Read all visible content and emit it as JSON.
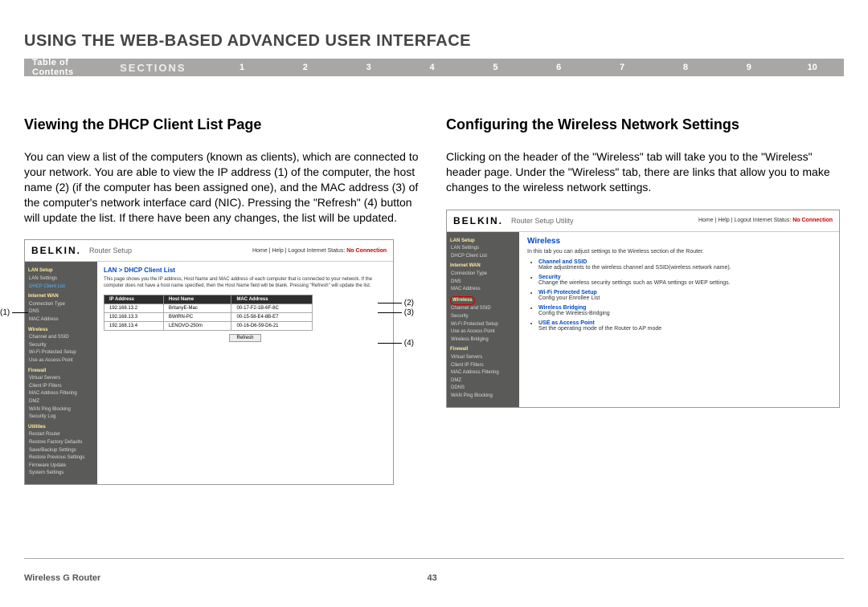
{
  "header": {
    "title": "USING THE WEB-BASED ADVANCED USER INTERFACE",
    "toc_label": "Table of Contents",
    "sections_label": "SECTIONS",
    "section_numbers": [
      "1",
      "2",
      "3",
      "4",
      "5",
      "6",
      "7",
      "8",
      "9",
      "10"
    ],
    "active_section": "6"
  },
  "left_col": {
    "heading": "Viewing the DHCP Client List Page",
    "paragraph": "You can view a list of the computers (known as clients), which are connected to your network. You are able to view the IP address (1) of the computer, the host name (2) (if the computer has been assigned one), and the MAC address (3) of the computer's network interface card (NIC). Pressing the \"Refresh\" (4) button will update the list. If there have been any changes, the list will be updated.",
    "callouts": {
      "c1": "(1)",
      "c2": "(2)",
      "c3": "(3)",
      "c4": "(4)"
    },
    "router": {
      "logo": "BELKIN.",
      "title": "Router Setup",
      "top_links": "Home | Help | Logout   Internet Status:",
      "status": "No Connection",
      "crumb": "LAN > DHCP Client List",
      "desc": "This page shows you the IP address, Host Name and MAC address of each computer that is connected to your network. If the computer does not have a host name specified, then the Host Name field will be blank. Pressing \"Refresh\" will update the list.",
      "table": {
        "headers": [
          "IP Address",
          "Host Name",
          "MAC Address"
        ],
        "rows": [
          [
            "192.168.13.2",
            "BritanyE-Mac",
            "00-17-F2-1B-6F-8C"
          ],
          [
            "192.168.13.3",
            "BWIRN-PC",
            "00-15-58-E4-8B-E7"
          ],
          [
            "192.168.13.4",
            "LENOVO-250m",
            "00-16-D6-59-D6-21"
          ]
        ]
      },
      "refresh": "Refresh",
      "sidebar": [
        {
          "t": "group",
          "v": "LAN Setup"
        },
        {
          "t": "item",
          "v": "LAN Settings"
        },
        {
          "t": "item sel",
          "v": "DHCP Client List"
        },
        {
          "t": "group",
          "v": "Internet WAN"
        },
        {
          "t": "item",
          "v": "Connection Type"
        },
        {
          "t": "item",
          "v": "DNS"
        },
        {
          "t": "item",
          "v": "MAC Address"
        },
        {
          "t": "group",
          "v": "Wireless"
        },
        {
          "t": "item",
          "v": "Channel and SSID"
        },
        {
          "t": "item",
          "v": "Security"
        },
        {
          "t": "item",
          "v": "Wi-Fi Protected Setup"
        },
        {
          "t": "item",
          "v": "Use as Access Point"
        },
        {
          "t": "group",
          "v": "Firewall"
        },
        {
          "t": "item",
          "v": "Virtual Servers"
        },
        {
          "t": "item",
          "v": "Client IP Filters"
        },
        {
          "t": "item",
          "v": "MAC Address Filtering"
        },
        {
          "t": "item",
          "v": "DMZ"
        },
        {
          "t": "item",
          "v": "WAN Ping Blocking"
        },
        {
          "t": "item",
          "v": "Security Log"
        },
        {
          "t": "group",
          "v": "Utilities"
        },
        {
          "t": "item",
          "v": "Restart Router"
        },
        {
          "t": "item",
          "v": "Restore Factory Defaults"
        },
        {
          "t": "item",
          "v": "Save/Backup Settings"
        },
        {
          "t": "item",
          "v": "Restore Previous Settings"
        },
        {
          "t": "item",
          "v": "Firmware Update"
        },
        {
          "t": "item",
          "v": "System Settings"
        }
      ]
    }
  },
  "right_col": {
    "heading": "Configuring the Wireless Network Settings",
    "paragraph": "Clicking on the header of the \"Wireless\" tab will take you to the \"Wireless\" header page. Under the \"Wireless\" tab, there are links that allow you to make changes to the wireless network settings.",
    "router": {
      "logo": "BELKIN.",
      "title": "Router Setup Utility",
      "top_links": "Home | Help | Logout   Internet Status:",
      "status": "No Connection",
      "h": "Wireless",
      "intro": "In this tab you can adjust settings to the Wireless section of the Router.",
      "bullets": [
        {
          "a": "Channel and SSID",
          "d": "Make adjustments to the wireless channel and SSID(wireless network name)."
        },
        {
          "a": "Security",
          "d": "Change the wireless security settings such as WPA settings or WEP settings."
        },
        {
          "a": "Wi-Fi Protected Setup",
          "d": "Config your Enrollee List"
        },
        {
          "a": "Wireless Bridging",
          "d": "Config the Wireless-Bridging"
        },
        {
          "a": "USE as Access Point",
          "d": "Set the operating mode of the Router to AP mode"
        }
      ],
      "sidebar": [
        {
          "t": "group",
          "v": "LAN Setup"
        },
        {
          "t": "item",
          "v": "LAN Settings"
        },
        {
          "t": "item",
          "v": "DHCP Client List"
        },
        {
          "t": "group",
          "v": "Internet WAN"
        },
        {
          "t": "item",
          "v": "Connection Type"
        },
        {
          "t": "item",
          "v": "DNS"
        },
        {
          "t": "item",
          "v": "MAC Address"
        },
        {
          "t": "group wsel",
          "v": "Wireless"
        },
        {
          "t": "item",
          "v": "Channel and SSID"
        },
        {
          "t": "item",
          "v": "Security"
        },
        {
          "t": "item",
          "v": "Wi-Fi Protected Setup"
        },
        {
          "t": "item",
          "v": "Use as Access Point"
        },
        {
          "t": "item",
          "v": "Wireless Bridging"
        },
        {
          "t": "group",
          "v": "Firewall"
        },
        {
          "t": "item",
          "v": "Virtual Servers"
        },
        {
          "t": "item",
          "v": "Client IP Filters"
        },
        {
          "t": "item",
          "v": "MAC Address Filtering"
        },
        {
          "t": "item",
          "v": "DMZ"
        },
        {
          "t": "item",
          "v": "DDNS"
        },
        {
          "t": "item",
          "v": "WAN Ping Blocking"
        }
      ]
    }
  },
  "footer": {
    "product": "Wireless G Router",
    "page": "43"
  }
}
